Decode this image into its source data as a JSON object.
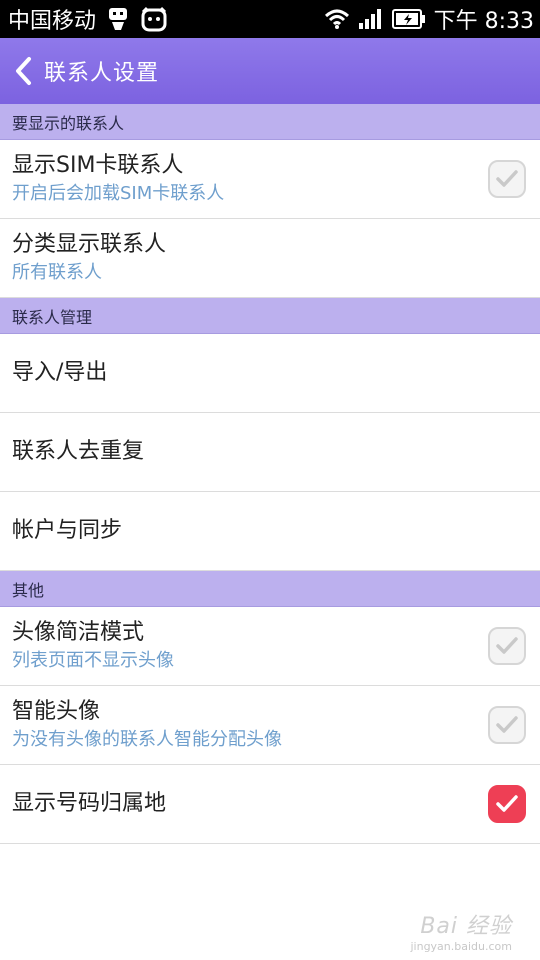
{
  "status_bar": {
    "carrier": "中国移动",
    "time": "下午 8:33"
  },
  "app_bar": {
    "title": "联系人设置"
  },
  "sections": [
    {
      "header": "要显示的联系人",
      "items": [
        {
          "title": "显示SIM卡联系人",
          "subtitle": "开启后会加载SIM卡联系人",
          "checkbox": false
        },
        {
          "title": "分类显示联系人",
          "subtitle": "所有联系人"
        }
      ]
    },
    {
      "header": "联系人管理",
      "items": [
        {
          "title": "导入/导出"
        },
        {
          "title": "联系人去重复"
        },
        {
          "title": "帐户与同步"
        }
      ]
    },
    {
      "header": "其他",
      "items": [
        {
          "title": "头像简洁模式",
          "subtitle": "列表页面不显示头像",
          "checkbox": false
        },
        {
          "title": "智能头像",
          "subtitle": "为没有头像的联系人智能分配头像",
          "checkbox": false
        },
        {
          "title": "显示号码归属地",
          "checkbox": true
        }
      ]
    }
  ],
  "watermark": {
    "main": "Bai 经验",
    "sub": "jingyan.baidu.com"
  },
  "colors": {
    "app_bar": "#8f79ea",
    "section_header": "#bcb0ee",
    "subtitle": "#6f9fcd",
    "check_on": "#ee3f55"
  }
}
